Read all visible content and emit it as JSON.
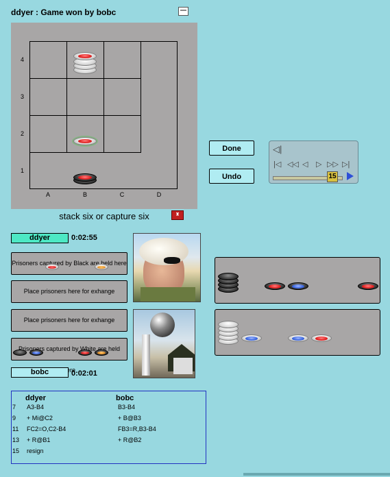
{
  "window": {
    "title": "ddyer : Game won by bobc"
  },
  "board": {
    "row_labels": [
      "4",
      "3",
      "2",
      "1"
    ],
    "col_labels": [
      "A",
      "B",
      "C",
      "D"
    ],
    "caption": "stack six or capture six"
  },
  "controls": {
    "done_label": "Done",
    "undo_label": "Undo",
    "replay_position": "15"
  },
  "players": [
    {
      "name": "ddyer",
      "time": "0:02:55",
      "accent": "#4de8c4"
    },
    {
      "name": "bobc",
      "time": "0:02:01",
      "accent": "#b0ecf2"
    }
  ],
  "boxes": {
    "black_prisoners": "Prisoners captured by Black are held here",
    "exchange_1": "Place prisoners here for exhange",
    "exchange_2": "Place prisoners here for exhange",
    "white_prisoners": "Prisoners captured by White are held here"
  },
  "history": {
    "headers": [
      "ddyer",
      "bobc"
    ],
    "rows": [
      {
        "num": "7",
        "a": "A3-B4",
        "b": "B3-B4"
      },
      {
        "num": "9",
        "a": "+ Mi@C2",
        "b": "+ B@B3"
      },
      {
        "num": "11",
        "a": "FC2=O,C2-B4",
        "b": "FB3=R,B3-B4"
      },
      {
        "num": "13",
        "a": "+ R@B1",
        "b": "+ R@B2"
      },
      {
        "num": "15",
        "a": "resign",
        "b": ""
      }
    ]
  },
  "colors": {
    "background": "#98d8e0",
    "board": "#a8a6a6",
    "history_border": "#2030c0"
  }
}
